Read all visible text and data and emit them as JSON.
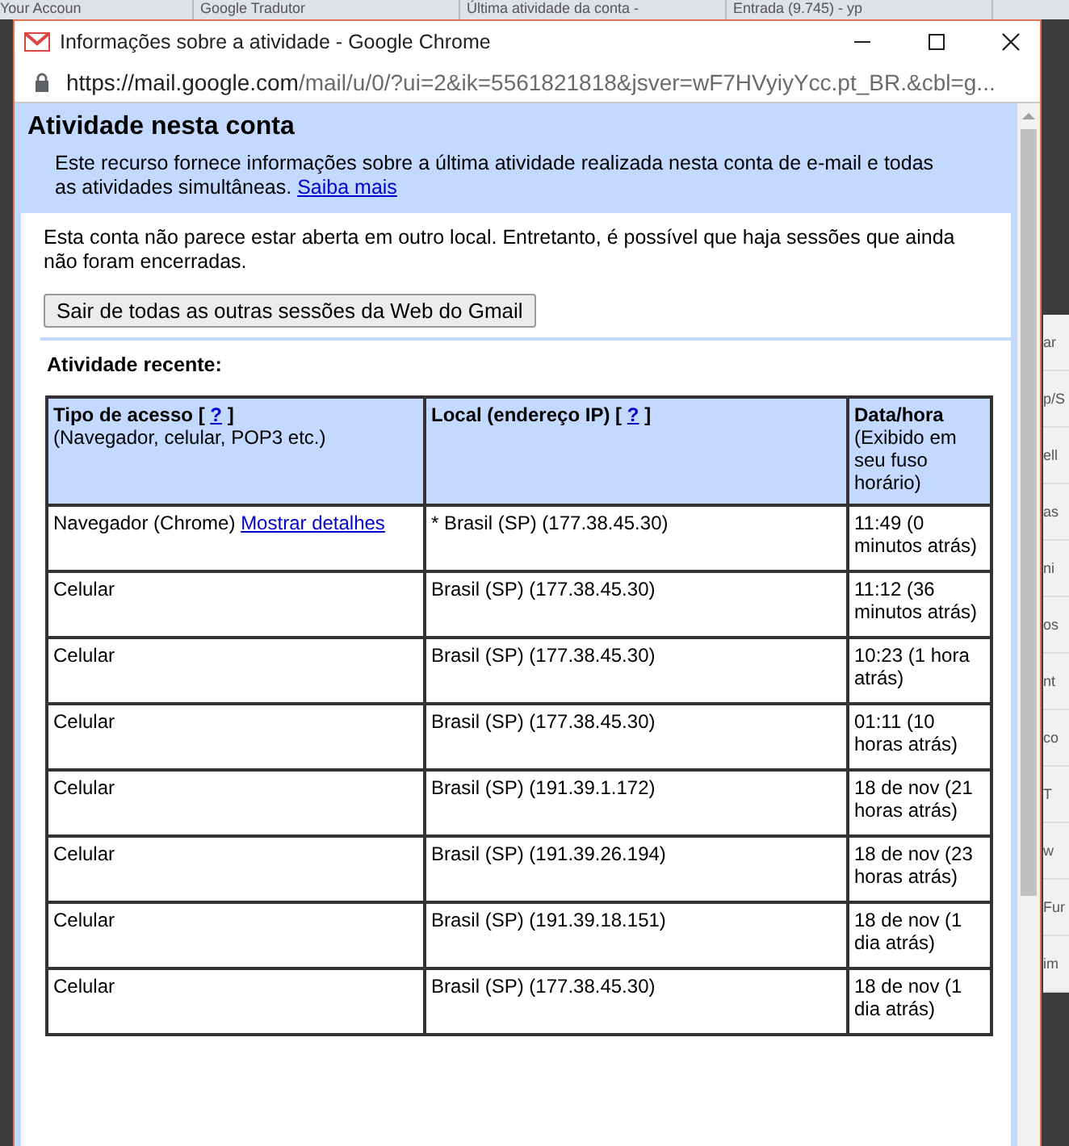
{
  "background_tabs": [
    {
      "title": "Your Accoun"
    },
    {
      "title": "Google Tradutor"
    },
    {
      "title": "Última atividade da conta -"
    },
    {
      "title": "Entrada (9.745) - yp"
    }
  ],
  "background_side": [
    "ar",
    "p/S",
    "ell",
    "as",
    "ni",
    "os",
    "nt",
    "co",
    "T",
    "w",
    "Fur",
    "im"
  ],
  "window": {
    "title": "Informações sobre a atividade - Google Chrome",
    "url_host": "https://mail.google.com",
    "url_path": "/mail/u/0/?ui=2&ik=5561821818&jsver=wF7HVyiyYcc.pt_BR.&cbl=g..."
  },
  "header": {
    "title": "Atividade nesta conta",
    "description": "Este recurso fornece informações sobre a última atividade realizada nesta conta de e-mail e todas as atividades simultâneas.",
    "link": "Saiba mais"
  },
  "notice": "Esta conta não parece estar aberta em outro local. Entretanto, é possível que haja sessões que ainda não foram encerradas.",
  "signout_button": "Sair de todas as outras sessões da Web do Gmail",
  "recent_title": "Atividade recente:",
  "table": {
    "columns": [
      {
        "title": "Tipo de acesso",
        "help": {
          "open": "[",
          "link": "?",
          "close": "]"
        },
        "note": "(Navegador, celular, POP3 etc.)"
      },
      {
        "title": "Local (endereço IP)",
        "help": {
          "open": "[",
          "link": "?",
          "close": "]"
        }
      },
      {
        "title": "Data/hora",
        "note": "(Exibido em seu fuso horário)"
      }
    ],
    "rows": [
      {
        "access": "Navegador (Chrome)",
        "details_link": "Mostrar detalhes",
        "location": "* Brasil (SP) (177.38.45.30)",
        "time": "11:49 (0 minutos atrás)"
      },
      {
        "access": "Celular",
        "location": "Brasil (SP) (177.38.45.30)",
        "time": "11:12 (36 minutos atrás)"
      },
      {
        "access": "Celular",
        "location": "Brasil (SP) (177.38.45.30)",
        "time": "10:23 (1 hora atrás)"
      },
      {
        "access": "Celular",
        "location": "Brasil (SP) (177.38.45.30)",
        "time": "01:11 (10 horas atrás)"
      },
      {
        "access": "Celular",
        "location": "Brasil (SP) (191.39.1.172)",
        "time": "18 de nov (21 horas atrás)"
      },
      {
        "access": "Celular",
        "location": "Brasil (SP) (191.39.26.194)",
        "time": "18 de nov (23 horas atrás)"
      },
      {
        "access": "Celular",
        "location": "Brasil (SP) (191.39.18.151)",
        "time": "18 de nov (1 dia atrás)"
      },
      {
        "access": "Celular",
        "location": "Brasil (SP) (177.38.45.30)",
        "time": "18 de nov (1 dia atrás)"
      }
    ]
  }
}
